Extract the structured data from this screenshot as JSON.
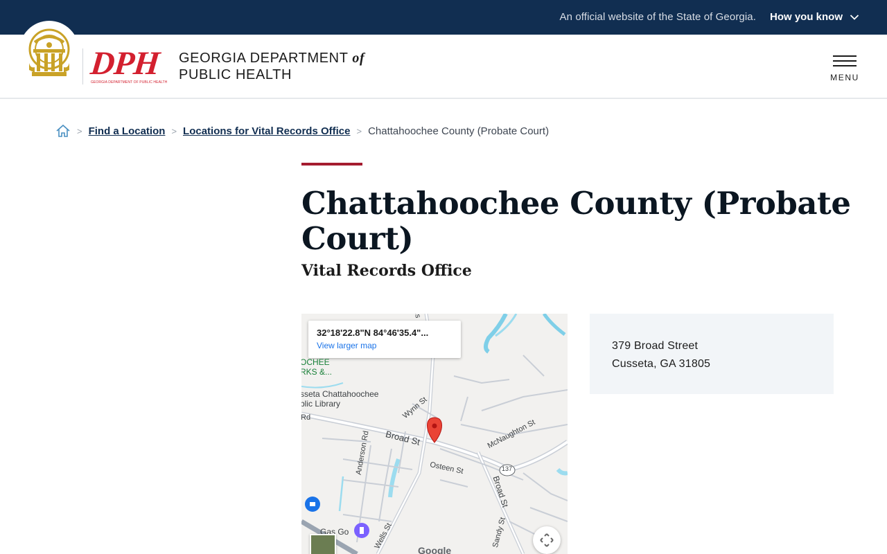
{
  "banner": {
    "official_text": "An official website of the State of Georgia.",
    "how_you_know": "How you know"
  },
  "header": {
    "dph_letters": "DPH",
    "dph_sub": "GEORGIA DEPARTMENT OF PUBLIC HEALTH",
    "dept_line1": "GEORGIA DEPARTMENT",
    "dept_of": "of",
    "dept_line2": "PUBLIC HEALTH",
    "menu_label": "MENU"
  },
  "breadcrumb": {
    "items": [
      "Find a Location",
      "Locations for Vital Records Office"
    ],
    "current": "Chattahoochee County (Probate Court)"
  },
  "page": {
    "title": "Chattahoochee County (Probate Court)",
    "subtitle": "Vital Records Office"
  },
  "map": {
    "coords": "32°18'22.8\"N 84°46'35.4\"...",
    "view_larger": "View larger map",
    "labels": {
      "park1": "OCHEE",
      "park2": "RKS &...",
      "library1": "sseta Chattahoochee",
      "library2": "blic Library",
      "rd": "Rd",
      "wynn": "Wynn St",
      "broad": "Broad St",
      "mcnaughton": "McNaughton St",
      "anderson": "Anderson Rd",
      "osteen": "Osteen St",
      "broad2": "Broad St",
      "route": "137",
      "sandy": "Sandy St",
      "wells": "Wells St",
      "gasgo": "Gas Go",
      "top_st": "lls"
    },
    "google": "Google"
  },
  "address": {
    "line1": "379 Broad Street",
    "line2": "Cusseta, GA 31805"
  },
  "colors": {
    "banner_bg": "#112e51",
    "accent": "#a51c30",
    "brand_red": "#d3202f",
    "seal_gold": "#c9a227"
  }
}
